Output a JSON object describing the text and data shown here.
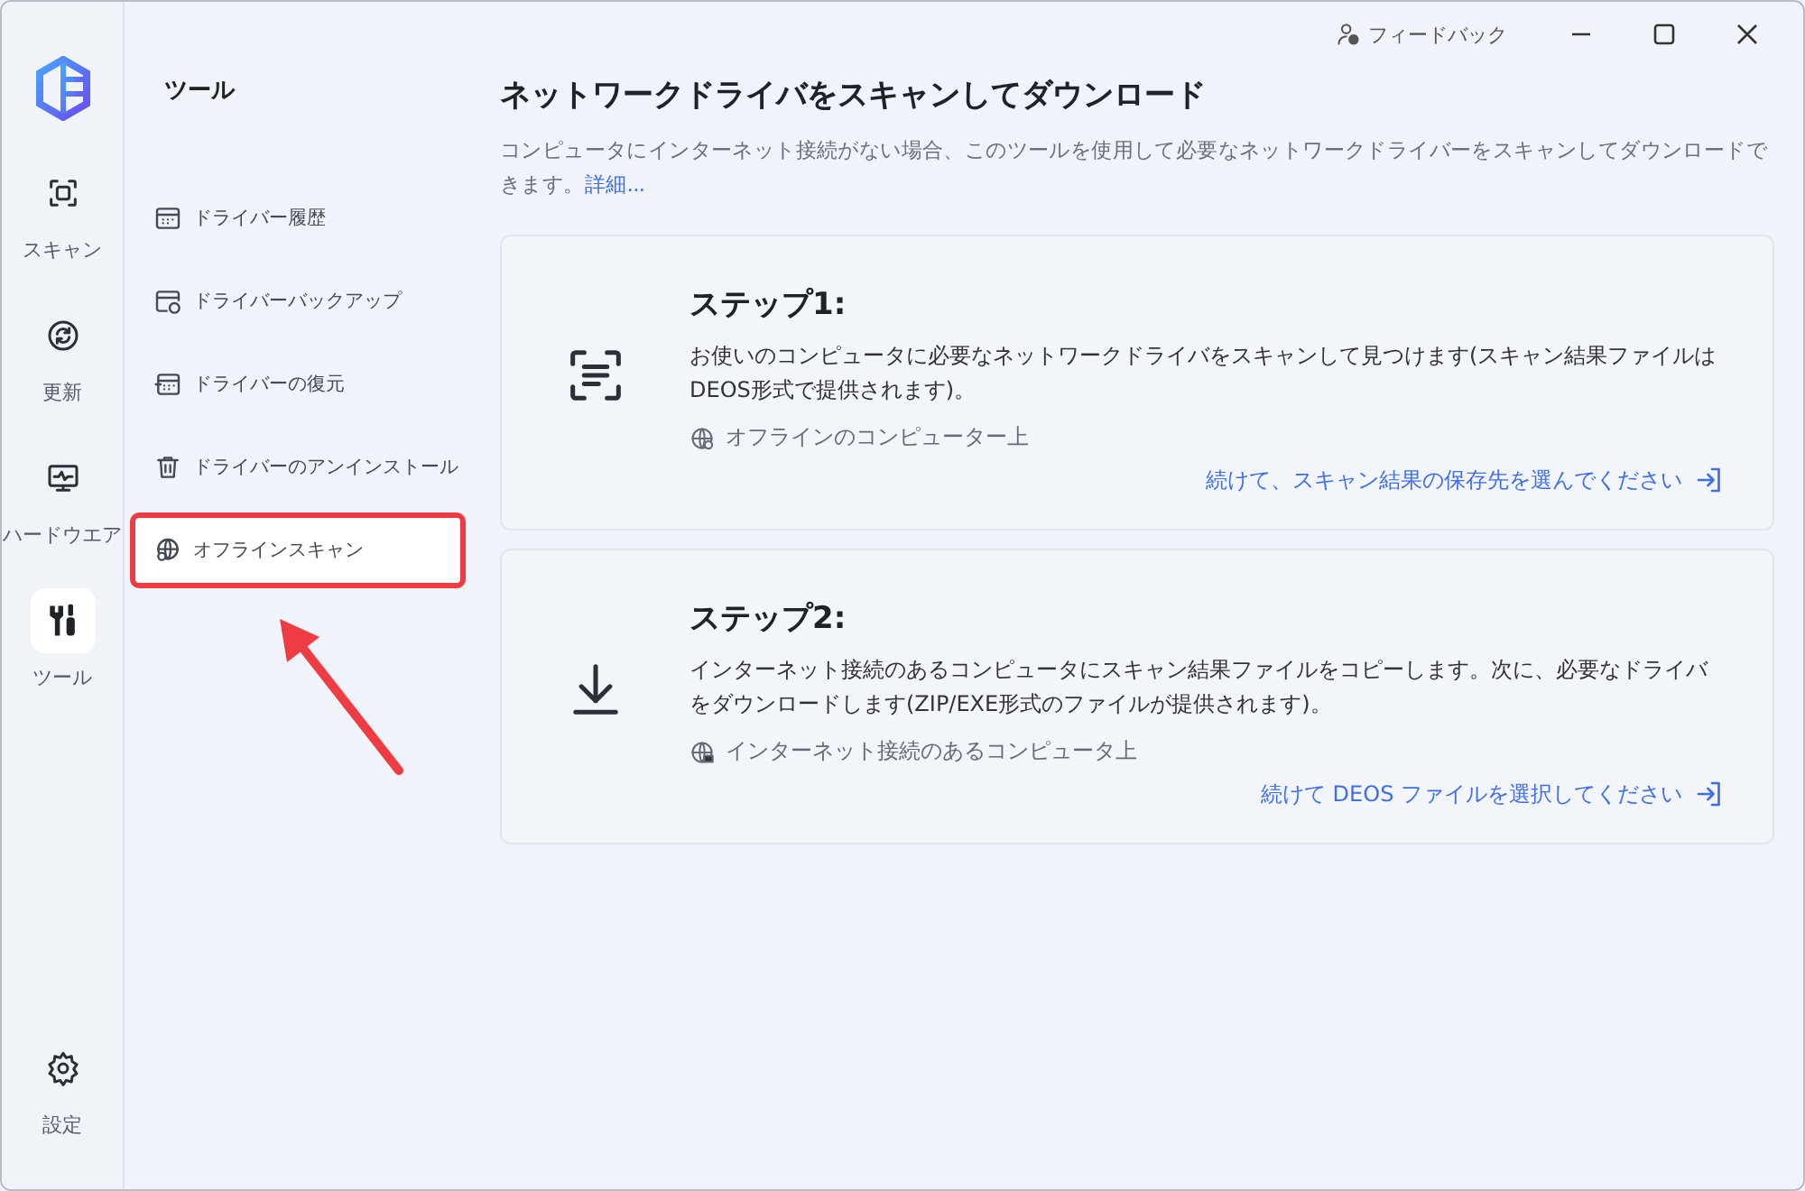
{
  "rail": {
    "items": [
      {
        "kind": "scan",
        "label": "スキャン",
        "selected": false
      },
      {
        "kind": "update",
        "label": "更新",
        "selected": false
      },
      {
        "kind": "hardware",
        "label": "ハードウエア",
        "selected": false
      },
      {
        "kind": "tools",
        "label": "ツール",
        "selected": true
      }
    ],
    "settings": {
      "label": "設定"
    }
  },
  "submenu": {
    "title": "ツール",
    "items": [
      {
        "kind": "history",
        "label": "ドライバー履歴",
        "selected": false
      },
      {
        "kind": "backup",
        "label": "ドライバーバックアップ",
        "selected": false
      },
      {
        "kind": "restore",
        "label": "ドライバーの復元",
        "selected": false
      },
      {
        "kind": "uninstall",
        "label": "ドライバーのアンインストール",
        "selected": false
      },
      {
        "kind": "offline",
        "label": "オフラインスキャン",
        "selected": true,
        "highlighted": true
      }
    ]
  },
  "titlebar": {
    "feedback": "フィードバック"
  },
  "main": {
    "title": "ネットワークドライバをスキャンしてダウンロード",
    "description": "コンピュータにインターネット接続がない場合、このツールを使用して必要なネットワークドライバーをスキャンしてダウンロードできます。",
    "more_link": "詳細...",
    "steps": [
      {
        "kind": "scan",
        "title": "ステップ1:",
        "text": "お使いのコンピュータに必要なネットワークドライバをスキャンして見つけます(スキャン結果ファイルはDEOS形式で提供されます)。",
        "location": "オフラインのコンピューター上",
        "action": "続けて、スキャン結果の保存先を選んでください"
      },
      {
        "kind": "download",
        "title": "ステップ2:",
        "text": "インターネット接続のあるコンピュータにスキャン結果ファイルをコピーします。次に、必要なドライバをダウンロードします(ZIP/EXE形式のファイルが提供されます)。",
        "location": "インターネット接続のあるコンピュータ上",
        "action": "続けて DEOS ファイルを選択してください"
      }
    ]
  }
}
